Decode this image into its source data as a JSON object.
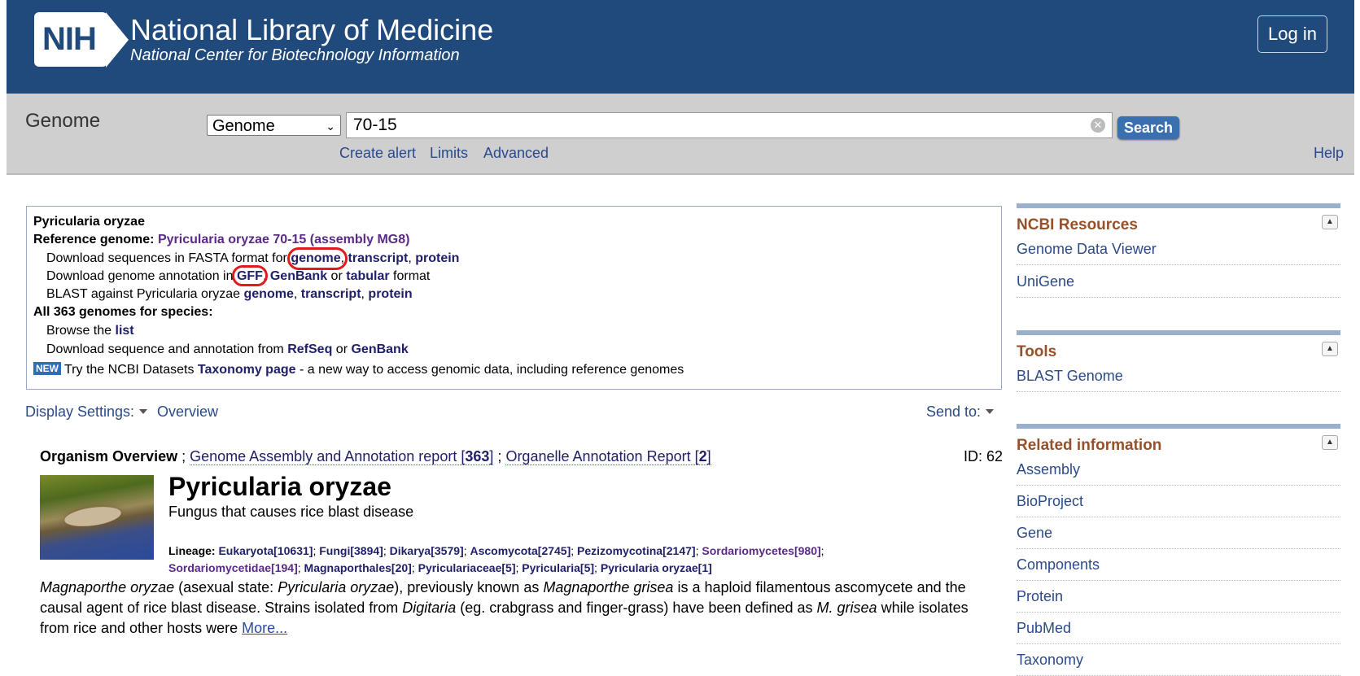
{
  "header": {
    "logo_text": "NIH",
    "title": "National Library of Medicine",
    "subtitle": "National Center for Biotechnology Information",
    "login_label": "Log in"
  },
  "search": {
    "db_label": "Genome",
    "db_selected": "Genome",
    "query_value": "70-15",
    "search_button": "Search",
    "links": [
      "Create alert",
      "Limits",
      "Advanced"
    ],
    "help": "Help"
  },
  "topbox": {
    "species": "Pyricularia oryzae",
    "ref_label": "Reference genome:",
    "ref_link": "Pyricularia oryzae 70-15 (assembly MG8)",
    "fasta_prefix": "Download sequences in FASTA format for",
    "fasta_links": [
      "genome",
      "transcript",
      "protein"
    ],
    "annot_prefix": "Download genome annotation in",
    "annot_links": [
      "GFF",
      "GenBank",
      "tabular"
    ],
    "annot_or": "or",
    "annot_suffix": "format",
    "blast_prefix": "BLAST against Pyricularia oryzae",
    "blast_links": [
      "genome",
      "transcript",
      "protein"
    ],
    "all_genomes": "All 363 genomes for species:",
    "browse_prefix": "Browse the",
    "browse_link": "list",
    "dl_prefix": "Download sequence and annotation from",
    "dl_links": [
      "RefSeq",
      "GenBank"
    ],
    "dl_or": "or",
    "new_badge": "NEW",
    "datasets_prefix": "Try the NCBI Datasets",
    "datasets_link": "Taxonomy page",
    "datasets_suffix": "- a new way to access genomic data, including reference genomes"
  },
  "display": {
    "settings_label": "Display Settings:",
    "overview_link": "Overview",
    "send_to": "Send to:"
  },
  "overview": {
    "label": "Organism Overview",
    "sep": ";",
    "report1_text": "Genome Assembly and Annotation report [",
    "report1_count": "363",
    "report1_close": "]",
    "report2_text": "Organelle Annotation Report [",
    "report2_count": "2",
    "report2_close": "]",
    "id_text": "ID: 62",
    "organism_name": "Pyricularia oryzae",
    "organism_desc": "Fungus that causes rice blast disease",
    "lineage_label": "Lineage:",
    "lineage": [
      {
        "name": "Eukaryota",
        "count": "10631"
      },
      {
        "name": "Fungi",
        "count": "3894"
      },
      {
        "name": "Dikarya",
        "count": "3579"
      },
      {
        "name": "Ascomycota",
        "count": "2745"
      },
      {
        "name": "Pezizomycotina",
        "count": "2147"
      },
      {
        "name": "Sordariomycetes",
        "count": "980"
      },
      {
        "name": "Sordariomycetidae",
        "count": "194"
      },
      {
        "name": "Magnaporthales",
        "count": "20"
      },
      {
        "name": "Pyriculariaceae",
        "count": "5"
      },
      {
        "name": "Pyricularia",
        "count": "5"
      },
      {
        "name": "Pyricularia oryzae",
        "count": "1"
      }
    ],
    "para_1": "Magnaporthe oryzae",
    "para_2": " (asexual state: ",
    "para_3": "Pyricularia oryzae",
    "para_4": "), previously known as ",
    "para_5": "Magnaporthe grisea",
    "para_6": " is a haploid filamentous ascomycete and the causal agent of rice blast disease. Strains isolated from ",
    "para_7": "Digitaria",
    "para_8": " (eg. crabgrass and finger-grass) have been defined as ",
    "para_9": "M. grisea",
    "para_10": " while isolates from rice and other hosts were ",
    "more_link": "More..."
  },
  "sidebar": {
    "resources_title": "NCBI Resources",
    "resources": [
      "Genome Data Viewer",
      "UniGene"
    ],
    "tools_title": "Tools",
    "tools": [
      "BLAST Genome"
    ],
    "related_title": "Related information",
    "related": [
      "Assembly",
      "BioProject",
      "Gene",
      "Components",
      "Protein",
      "PubMed",
      "Taxonomy"
    ]
  }
}
